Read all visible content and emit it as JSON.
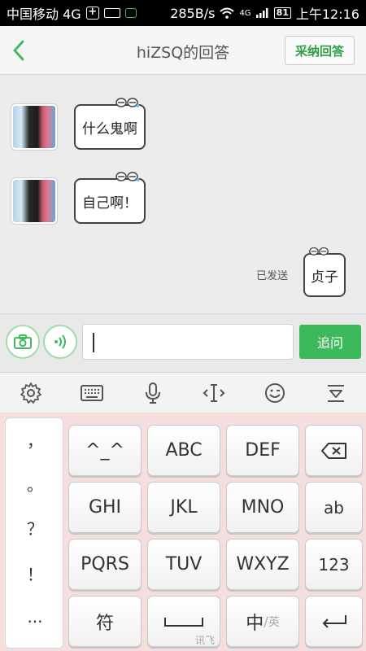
{
  "status_bar": {
    "carrier": "中国移动 4G",
    "speed": "285B/s",
    "network": "4G",
    "battery": "81",
    "time": "上午12:16"
  },
  "header": {
    "title": "hiZSQ的回答",
    "adopt_button": "采纳回答",
    "back_icon": "chevron-left-icon"
  },
  "messages": [
    {
      "side": "left",
      "text": "什么鬼啊"
    },
    {
      "side": "left",
      "text": "自己啊！"
    },
    {
      "side": "right",
      "text": "贞子",
      "status": "已发送"
    }
  ],
  "input_bar": {
    "value": "",
    "send_label": "追问",
    "camera_icon": "camera-icon",
    "voice_icon": "voice-icon"
  },
  "keyboard_toolbar": {
    "icons": [
      "gear-icon",
      "keyboard-icon",
      "microphone-icon",
      "cursor-icon",
      "emoji-icon",
      "collapse-icon"
    ]
  },
  "keyboard": {
    "punctuation": [
      "，",
      "。",
      "？",
      "！",
      "..."
    ],
    "row1": [
      "^_^",
      "ABC",
      "DEF"
    ],
    "row2": [
      "GHI",
      "JKL",
      "MNO",
      "ab"
    ],
    "row3": [
      "PQRS",
      "TUV",
      "WXYZ",
      "123"
    ],
    "row4": [
      "符",
      "中",
      "英"
    ],
    "brand": "讯飞"
  },
  "colors": {
    "accent_green": "#3cb95b",
    "header_bg": "#f5f5f5"
  }
}
